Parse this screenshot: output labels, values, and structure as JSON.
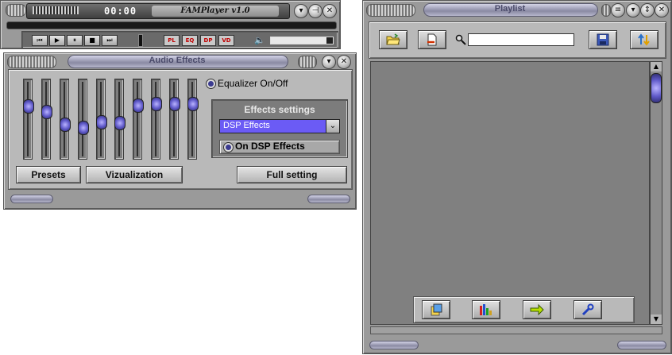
{
  "player": {
    "time": "00:00",
    "title": "FAMPlayer v1.0",
    "transport": [
      {
        "name": "prev-button",
        "glyph": "⏮"
      },
      {
        "name": "play-button",
        "glyph": "▶"
      },
      {
        "name": "pause-button",
        "glyph": "⏸"
      },
      {
        "name": "stop-button",
        "glyph": "■"
      },
      {
        "name": "next-button",
        "glyph": "⏭"
      }
    ],
    "modes": [
      {
        "name": "pl-button",
        "label": "PL"
      },
      {
        "name": "eq-button",
        "label": "EQ"
      },
      {
        "name": "dp-button",
        "label": "DP"
      },
      {
        "name": "vd-button",
        "label": "VD"
      }
    ],
    "volume": 0.9
  },
  "audio": {
    "title": "Audio Effects",
    "eq_toggle_label": "Equalizer On/Off",
    "effects_group_label": "Effects settings",
    "effects_select_value": "DSP Effects",
    "dsp_toggle_label": "On DSP Effects",
    "presets_label": "Presets",
    "vizualization_label": "Vizualization",
    "full_setting_label": "Full setting",
    "sliders": [
      0.3,
      0.38,
      0.57,
      0.62,
      0.54,
      0.55,
      0.29,
      0.26,
      0.26,
      0.26
    ],
    "accent": "#6b5bf5"
  },
  "playlist": {
    "title": "Playlist",
    "search_value": "",
    "toolbar_icons": [
      "open-folder-icon",
      "remove-file-icon",
      "save-icon",
      "sort-icon"
    ],
    "bottom_icons": [
      "add-files-icon",
      "statistics-icon",
      "arrow-right-icon",
      "settings-wrench-icon"
    ]
  }
}
